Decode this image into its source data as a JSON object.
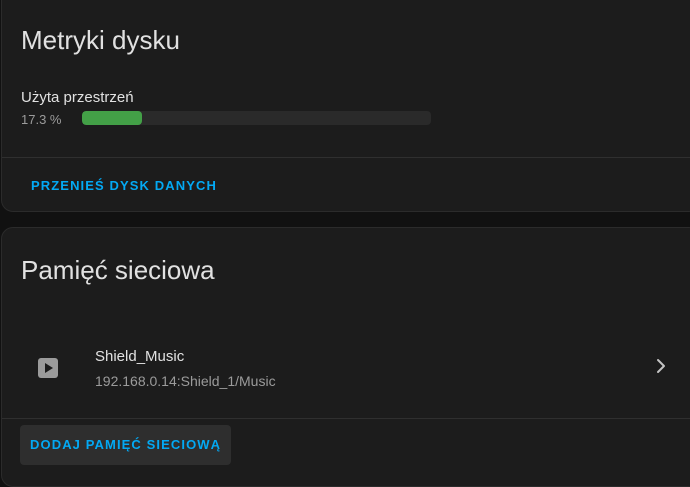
{
  "disk_metrics": {
    "title": "Metryki dysku",
    "usage_label": "Użyta przestrzeń",
    "usage_percent_text": "17.3 %",
    "usage_fraction": 0.173,
    "move_button_label": "PRZENIEŚ DYSK DANYCH"
  },
  "network_storage": {
    "title": "Pamięć sieciowa",
    "items": [
      {
        "name": "Shield_Music",
        "path": "192.168.0.14:Shield_1/Music",
        "icon": "play-icon"
      }
    ],
    "add_button_label": "DODAJ PAMIĘĆ SIECIOWĄ"
  },
  "colors": {
    "background": "#111111",
    "card": "#1c1c1c",
    "accent": "#03a9f4",
    "progress": "#43a047",
    "text_primary": "#e1e1e1",
    "text_secondary": "#9b9b9b"
  }
}
